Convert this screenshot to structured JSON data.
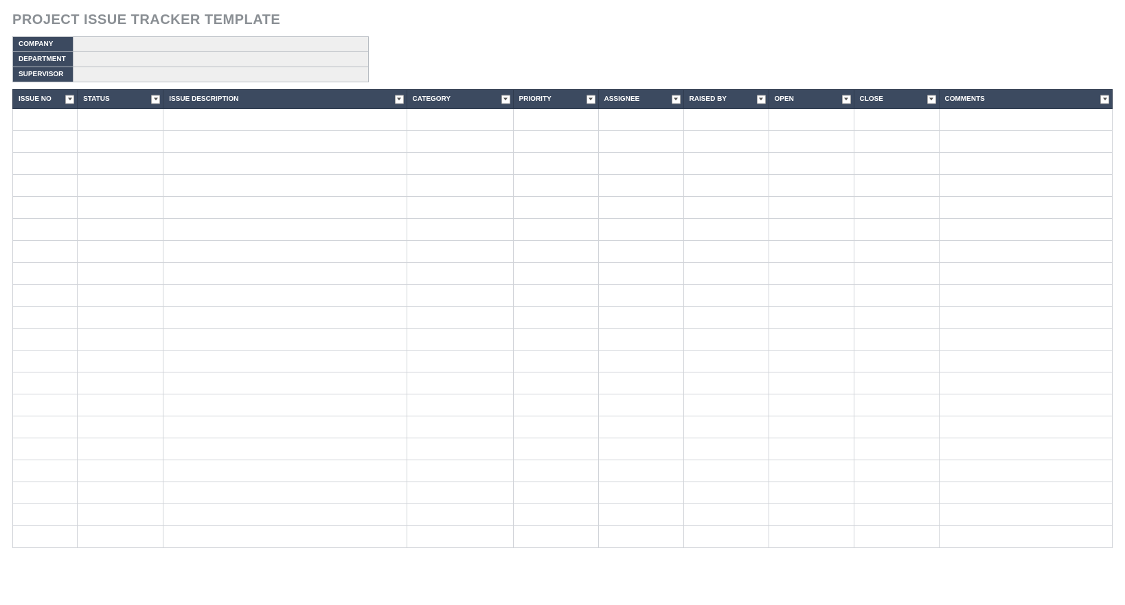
{
  "title": "PROJECT ISSUE TRACKER TEMPLATE",
  "info": {
    "company_label": "COMPANY",
    "company_value": "",
    "department_label": "DEPARTMENT",
    "department_value": "",
    "supervisor_label": "SUPERVISOR",
    "supervisor_value": ""
  },
  "columns": {
    "issue_no": "ISSUE NO",
    "status": "STATUS",
    "description": "ISSUE DESCRIPTION",
    "category": "CATEGORY",
    "priority": "PRIORITY",
    "assignee": "ASSIGNEE",
    "raised_by": "RAISED BY",
    "open": "OPEN",
    "close": "CLOSE",
    "comments": "COMMENTS"
  },
  "row_count": 20
}
